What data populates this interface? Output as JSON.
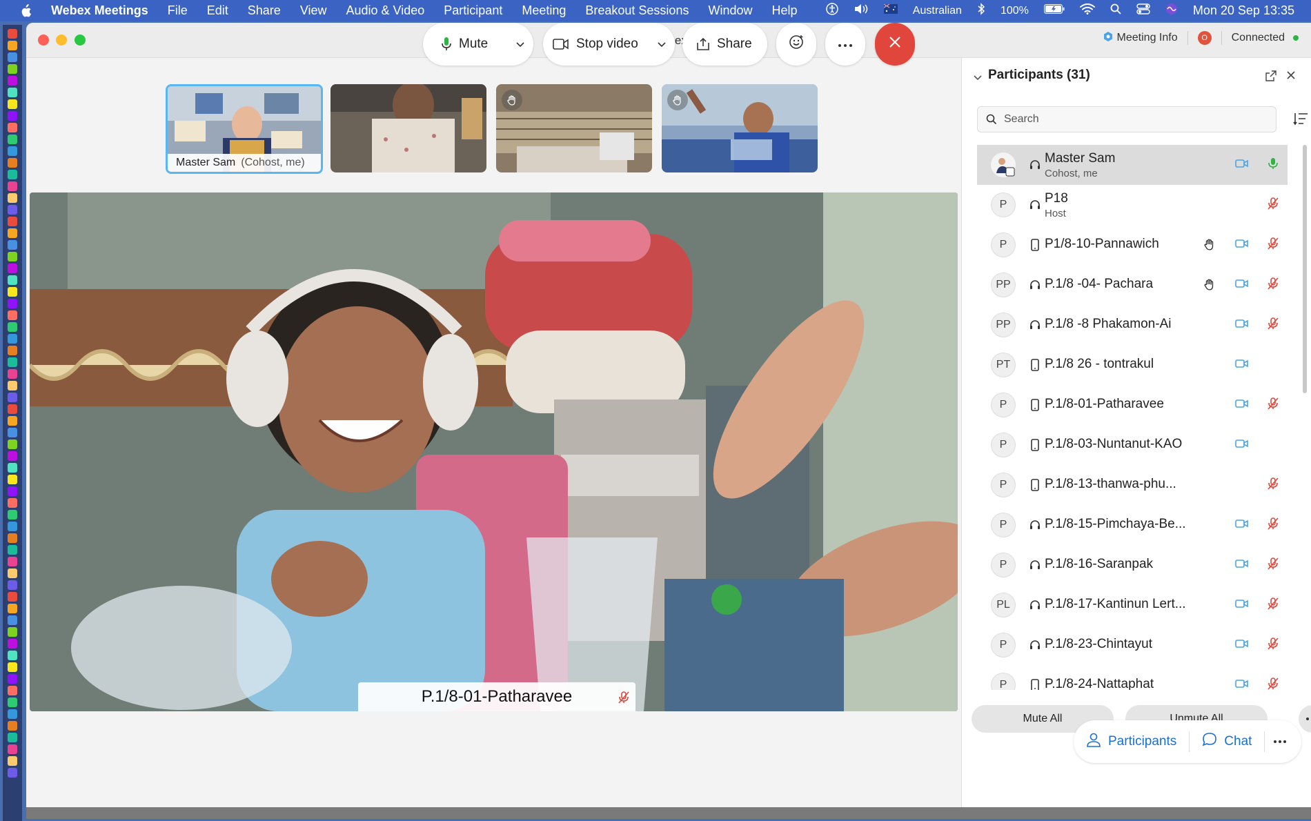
{
  "menubar": {
    "app_name": "Webex Meetings",
    "items": [
      "File",
      "Edit",
      "Share",
      "View",
      "Audio & Video",
      "Participant",
      "Meeting",
      "Breakout Sessions",
      "Window",
      "Help"
    ],
    "input_source": "Australian",
    "battery": "100%",
    "clock": "Mon 20 Sep  13:35"
  },
  "window": {
    "title": "Cisco Webex Meetings",
    "meeting_info": "Meeting Info",
    "recording_badge": "O",
    "status": "Connected"
  },
  "thumbnails": [
    {
      "name": "Master Sam",
      "role": "(Cohost, me)",
      "hand_raised": false
    },
    {
      "name": "",
      "role": "",
      "hand_raised": false
    },
    {
      "name": "",
      "role": "",
      "hand_raised": true
    },
    {
      "name": "",
      "role": "",
      "hand_raised": true
    }
  ],
  "active_speaker": {
    "name": "P.1/8-01-Patharavee",
    "muted": true
  },
  "controls": {
    "mute_label": "Mute",
    "stop_video_label": "Stop video",
    "share_label": "Share"
  },
  "panel": {
    "title": "Participants (31)",
    "search_placeholder": "Search",
    "mute_all": "Mute All",
    "unmute_all": "Unmute All",
    "participants": [
      {
        "initials": "",
        "name": "Master Sam",
        "role": "Cohost, me",
        "device": "headset",
        "hand": false,
        "video": true,
        "mic": "unmuted",
        "photo": true
      },
      {
        "initials": "P",
        "name": "P18",
        "role": "Host",
        "device": "headset",
        "hand": false,
        "video": false,
        "mic": "muted"
      },
      {
        "initials": "P",
        "name": "P1/8-10-Pannawich",
        "role": "",
        "device": "phone",
        "hand": true,
        "video": true,
        "mic": "muted"
      },
      {
        "initials": "PP",
        "name": "P.1/8 -04- Pachara",
        "role": "",
        "device": "headset",
        "hand": true,
        "video": true,
        "mic": "muted"
      },
      {
        "initials": "PP",
        "name": "P.1/8 -8 Phakamon-Ai",
        "role": "",
        "device": "headset",
        "hand": false,
        "video": true,
        "mic": "muted"
      },
      {
        "initials": "PT",
        "name": "P.1/8 26 - tontrakul",
        "role": "",
        "device": "phone",
        "hand": false,
        "video": true,
        "mic": "none"
      },
      {
        "initials": "P",
        "name": "P.1/8-01-Patharavee",
        "role": "",
        "device": "phone",
        "hand": false,
        "video": true,
        "mic": "muted"
      },
      {
        "initials": "P",
        "name": "P.1/8-03-Nuntanut-KAO",
        "role": "",
        "device": "phone",
        "hand": false,
        "video": true,
        "mic": "none"
      },
      {
        "initials": "P",
        "name": "P.1/8-13-thanwa-phu...",
        "role": "",
        "device": "phone",
        "hand": false,
        "video": false,
        "mic": "muted"
      },
      {
        "initials": "P",
        "name": "P.1/8-15-Pimchaya-Be...",
        "role": "",
        "device": "headset",
        "hand": false,
        "video": true,
        "mic": "muted"
      },
      {
        "initials": "P",
        "name": "P.1/8-16-Saranpak",
        "role": "",
        "device": "headset",
        "hand": false,
        "video": true,
        "mic": "muted"
      },
      {
        "initials": "PL",
        "name": "P.1/8-17-Kantinun Lert...",
        "role": "",
        "device": "headset",
        "hand": false,
        "video": true,
        "mic": "muted"
      },
      {
        "initials": "P",
        "name": "P.1/8-23-Chintayut",
        "role": "",
        "device": "headset",
        "hand": false,
        "video": true,
        "mic": "muted"
      },
      {
        "initials": "P",
        "name": "P.1/8-24-Nattaphat",
        "role": "",
        "device": "phone",
        "hand": false,
        "video": true,
        "mic": "muted"
      }
    ]
  },
  "bottom_right": {
    "participants_label": "Participants",
    "chat_label": "Chat"
  },
  "colors": {
    "accent": "#1a6fd4",
    "muted_red": "#e0463b",
    "unmuted_green": "#2fb344",
    "video_blue": "#4aa3e8",
    "leave_red": "#e0463b"
  }
}
